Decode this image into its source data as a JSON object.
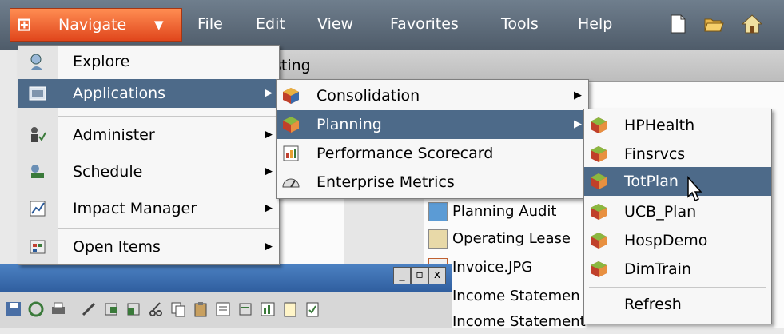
{
  "menubar": {
    "navigate_label": "Navigate",
    "items": [
      "File",
      "Edit",
      "View",
      "Favorites",
      "Tools",
      "Help"
    ],
    "toolbar_icons": [
      "new-document-icon",
      "open-folder-icon",
      "home-icon"
    ]
  },
  "background": {
    "strip_text": "sting",
    "list_rows": [
      "Planning Audit",
      "Operating Lease",
      "Invoice.JPG",
      "Income Statemen",
      "Income Statement"
    ],
    "window_buttons": [
      "_",
      "▫",
      "x"
    ]
  },
  "menu_main": {
    "items": [
      {
        "label": "Explore",
        "icon": "explore-icon",
        "submenu": false
      },
      {
        "label": "Applications",
        "icon": "applications-icon",
        "submenu": true
      },
      {
        "label": "Administer",
        "icon": "administer-icon",
        "submenu": true
      },
      {
        "label": "Schedule",
        "icon": "schedule-icon",
        "submenu": true
      },
      {
        "label": "Impact Manager",
        "icon": "impact-manager-icon",
        "submenu": true
      },
      {
        "label": "Open Items",
        "icon": "open-items-icon",
        "submenu": true
      }
    ]
  },
  "menu_applications": {
    "items": [
      {
        "label": "Consolidation",
        "icon": "consolidation-icon",
        "submenu": true
      },
      {
        "label": "Planning",
        "icon": "planning-icon",
        "submenu": true
      },
      {
        "label": "Performance Scorecard",
        "icon": "scorecard-icon",
        "submenu": false
      },
      {
        "label": "Enterprise Metrics",
        "icon": "metrics-icon",
        "submenu": false
      }
    ]
  },
  "menu_planning": {
    "items": [
      {
        "label": "HPHealth"
      },
      {
        "label": "Finsrvcs"
      },
      {
        "label": "TotPlan"
      },
      {
        "label": "UCB_Plan"
      },
      {
        "label": "HospDemo"
      },
      {
        "label": "DimTrain"
      }
    ],
    "refresh_label": "Refresh"
  },
  "colors": {
    "menubar": "#5d6b79",
    "navigate": "#f26a35",
    "highlight": "#4d6a89",
    "menu_bg": "#f7f7f7"
  }
}
